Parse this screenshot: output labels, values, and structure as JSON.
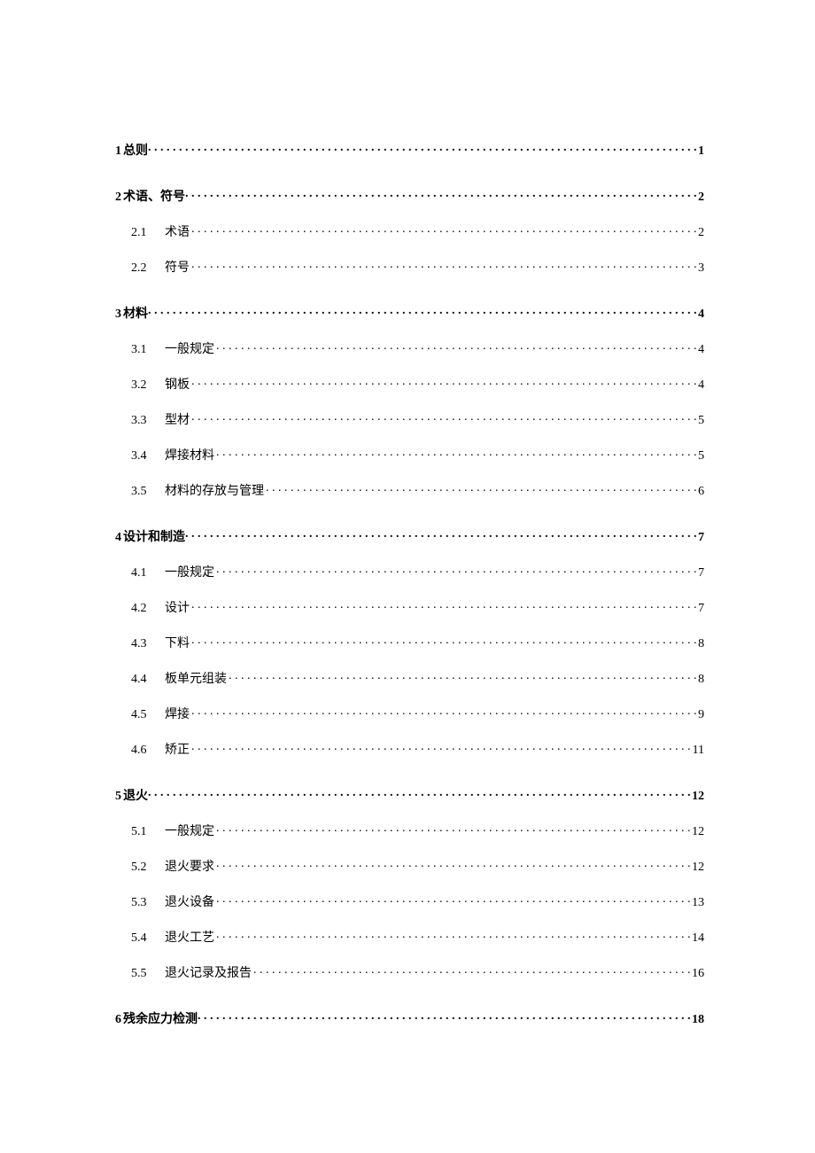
{
  "toc": [
    {
      "level": 1,
      "num": "1",
      "title": "总则",
      "page": "1"
    },
    {
      "level": 1,
      "num": "2",
      "title": "术语、符号",
      "page": "2"
    },
    {
      "level": 2,
      "num": "2.1",
      "title": "术语",
      "page": "2"
    },
    {
      "level": 2,
      "num": "2.2",
      "title": "符号",
      "page": "3"
    },
    {
      "level": 1,
      "num": "3",
      "title": "材料",
      "page": "4"
    },
    {
      "level": 2,
      "num": "3.1",
      "title": "一般规定",
      "page": "4"
    },
    {
      "level": 2,
      "num": "3.2",
      "title": "钢板",
      "page": "4"
    },
    {
      "level": 2,
      "num": "3.3",
      "title": "型材",
      "page": "5"
    },
    {
      "level": 2,
      "num": "3.4",
      "title": "焊接材料",
      "page": "5"
    },
    {
      "level": 2,
      "num": "3.5",
      "title": "材料的存放与管理",
      "page": "6"
    },
    {
      "level": 1,
      "num": "4",
      "title": "设计和制造",
      "page": "7"
    },
    {
      "level": 2,
      "num": "4.1",
      "title": "一般规定",
      "page": "7"
    },
    {
      "level": 2,
      "num": "4.2",
      "title": "设计",
      "page": "7"
    },
    {
      "level": 2,
      "num": "4.3",
      "title": "下料",
      "page": "8"
    },
    {
      "level": 2,
      "num": "4.4",
      "title": "板单元组装",
      "page": "8"
    },
    {
      "level": 2,
      "num": "4.5",
      "title": "焊接",
      "page": "9"
    },
    {
      "level": 2,
      "num": "4.6",
      "title": "矫正",
      "page": "11"
    },
    {
      "level": 1,
      "num": "5",
      "title": "退火",
      "page": "12"
    },
    {
      "level": 2,
      "num": "5.1",
      "title": "一般规定",
      "page": "12"
    },
    {
      "level": 2,
      "num": "5.2",
      "title": "退火要求",
      "page": "12"
    },
    {
      "level": 2,
      "num": "5.3",
      "title": "退火设备",
      "page": "13"
    },
    {
      "level": 2,
      "num": "5.4",
      "title": "退火工艺",
      "page": "14"
    },
    {
      "level": 2,
      "num": "5.5",
      "title": "退火记录及报告",
      "page": "16"
    },
    {
      "level": 1,
      "num": "6",
      "title": "残余应力检测",
      "page": "18"
    }
  ]
}
